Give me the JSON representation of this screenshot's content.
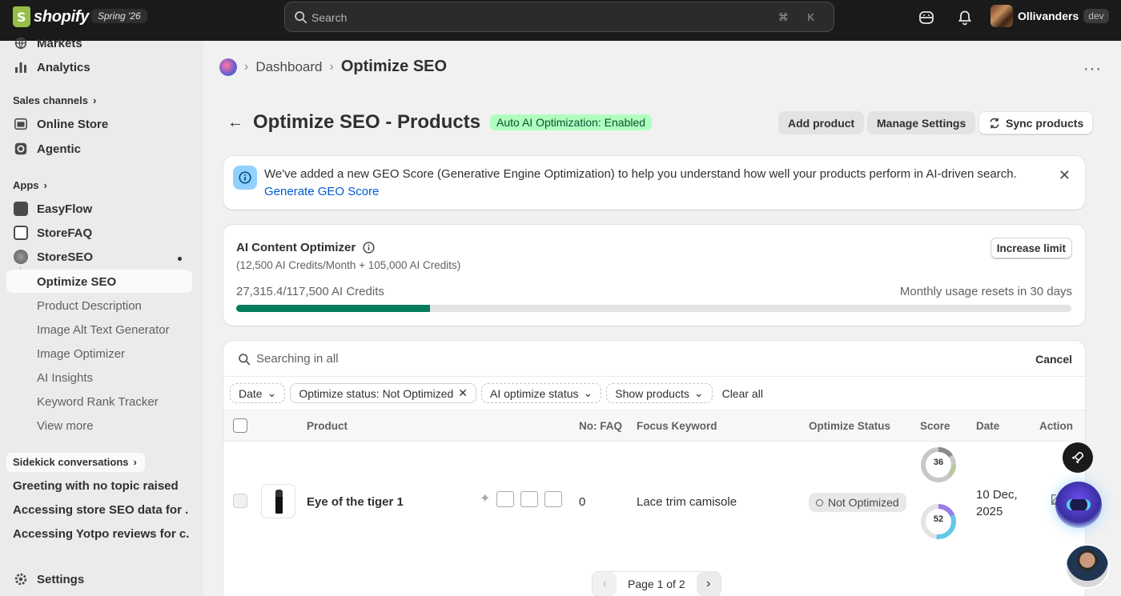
{
  "topbar": {
    "logo_text": "shopify",
    "release": "Spring '26",
    "search_placeholder": "Search",
    "shortcut": "⌘ K",
    "store_name": "Ollivanders",
    "store_badge": "dev"
  },
  "sidebar": {
    "top_items": [
      {
        "label": "Markets",
        "icon": "globe-icon"
      },
      {
        "label": "Analytics",
        "icon": "bar-chart-icon"
      }
    ],
    "sales_channels_label": "Sales channels",
    "channels": [
      {
        "label": "Online Store",
        "icon": "store-icon"
      },
      {
        "label": "Agentic",
        "icon": "agentic-icon"
      }
    ],
    "apps_label": "Apps",
    "apps": [
      {
        "label": "EasyFlow",
        "icon": "easyflow-icon"
      },
      {
        "label": "StoreFAQ",
        "icon": "storefaq-icon"
      },
      {
        "label": "StoreSEO",
        "icon": "storeseo-icon"
      }
    ],
    "sub_items": [
      "Optimize SEO",
      "Product Description",
      "Image Alt Text Generator",
      "Image Optimizer",
      "AI Insights",
      "Keyword Rank Tracker",
      "View more"
    ],
    "sidekick_label": "Sidekick conversations",
    "conversations": [
      "Greeting with no topic raised",
      "Accessing store SEO data for ...",
      "Accessing Yotpo reviews for c..."
    ],
    "settings_label": "Settings"
  },
  "breadcrumb": {
    "link": "Dashboard",
    "current": "Optimize SEO"
  },
  "page": {
    "title": "Optimize SEO - Products",
    "status_badge": "Auto AI Optimization: Enabled",
    "buttons": {
      "add_product": "Add product",
      "manage_settings": "Manage Settings",
      "sync_products": "Sync products"
    }
  },
  "banner": {
    "text": "We've added a new GEO Score (Generative Engine Optimization) to help you understand how well your products perform in AI-driven search.",
    "link": "Generate GEO Score"
  },
  "credits": {
    "title": "AI Content Optimizer",
    "subtitle": "(12,500 AI Credits/Month + 105,000 AI Credits)",
    "increase_label": "Increase limit",
    "usage": "27,315.4/117,500 AI Credits",
    "reset_note": "Monthly usage resets in 30 days",
    "used_fraction": 0.2325
  },
  "table": {
    "search_text": "Searching in all",
    "cancel_label": "Cancel",
    "filters": {
      "date": "Date",
      "optimize_status": "Optimize status: Not Optimized",
      "ai_status": "AI optimize status",
      "show_products": "Show products",
      "clear_all": "Clear all"
    },
    "headers": {
      "product": "Product",
      "faq": "No: FAQ",
      "keyword": "Focus Keyword",
      "status": "Optimize Status",
      "score": "Score",
      "date": "Date",
      "action": "Action"
    },
    "rows": [
      {
        "product": "Eye of the tiger 1",
        "faq": "0",
        "keyword": "Lace trim camisole",
        "status": "Not Optimized",
        "score_seo": "36",
        "score_geo": "52",
        "date_line1": "10 Dec,",
        "date_line2": "2025"
      }
    ],
    "pagination": "Page 1 of 2"
  },
  "colors": {
    "accent_green": "#047b5d",
    "badge_green_bg": "#affebf",
    "link_blue": "#005bd3"
  }
}
